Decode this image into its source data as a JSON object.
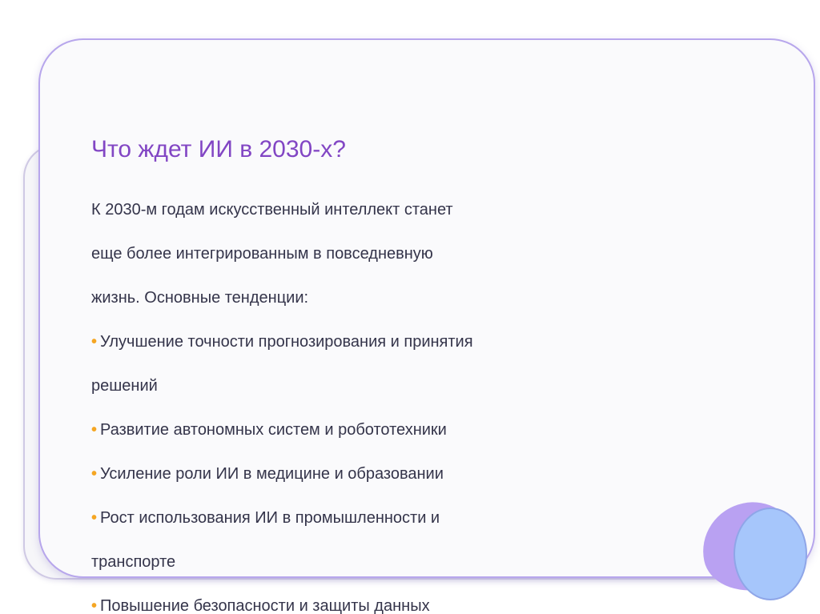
{
  "slide": {
    "title": "Что ждет ИИ в 2030-х?",
    "bullet_symbol": "•",
    "lines": [
      {
        "text": "К 2030-м годам искусственный интеллект станет",
        "bullet": false
      },
      {
        "text": "еще более интегрированным в повседневную",
        "bullet": false
      },
      {
        "text": "жизнь. Основные тенденции:",
        "bullet": false
      },
      {
        "text": "Улучшение точности прогнозирования и принятия",
        "bullet": true
      },
      {
        "text": "решений",
        "bullet": false
      },
      {
        "text": "Развитие автономных систем и робототехники",
        "bullet": true
      },
      {
        "text": "Усиление роли ИИ в медицине и образовании",
        "bullet": true
      },
      {
        "text": "Рост использования ИИ в промышленности и",
        "bullet": true
      },
      {
        "text": "транспорте",
        "bullet": false
      },
      {
        "text": "Повышение безопасности и защиты данных",
        "bullet": true
      }
    ]
  },
  "colors": {
    "title": "#8246c4",
    "body_text": "#34344a",
    "bullet": "#f5a623",
    "card_border": "#b7a6ec",
    "blob_purple": "#b9a1f2",
    "blob_blue": "#a6c6fb"
  }
}
